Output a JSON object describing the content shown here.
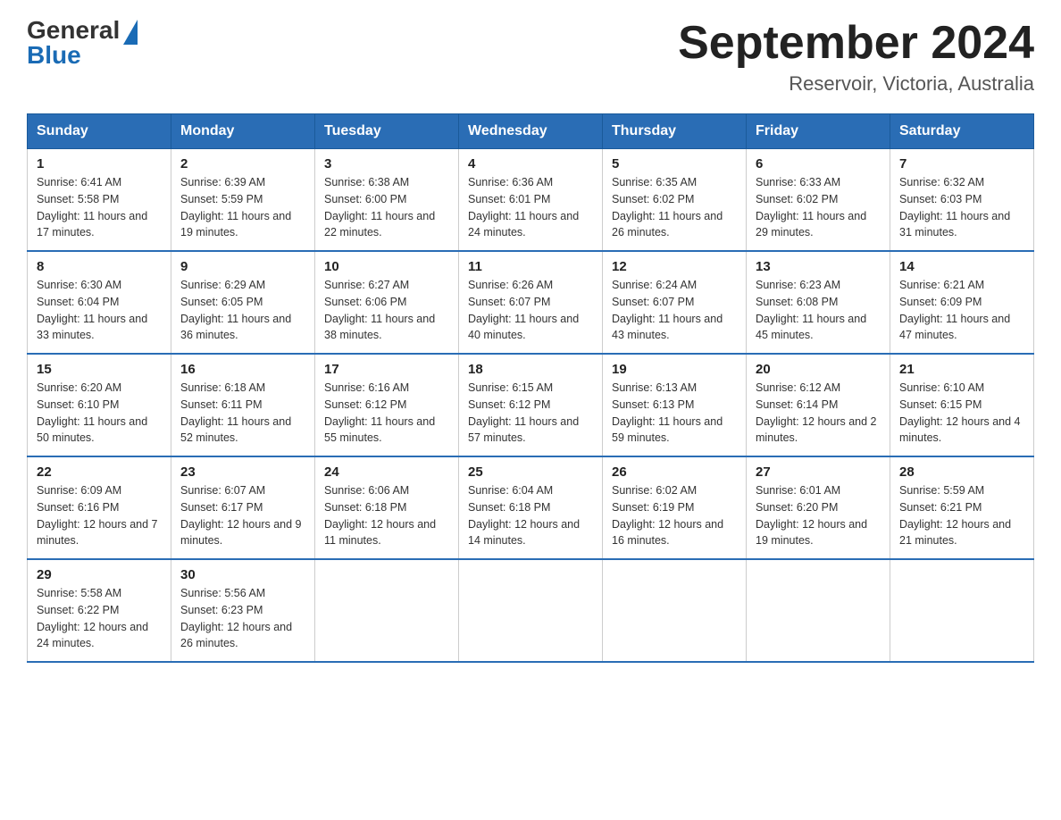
{
  "header": {
    "title": "September 2024",
    "subtitle": "Reservoir, Victoria, Australia",
    "logo_general": "General",
    "logo_blue": "Blue"
  },
  "days_of_week": [
    "Sunday",
    "Monday",
    "Tuesday",
    "Wednesday",
    "Thursday",
    "Friday",
    "Saturday"
  ],
  "weeks": [
    [
      {
        "day": "1",
        "sunrise": "6:41 AM",
        "sunset": "5:58 PM",
        "daylight": "11 hours and 17 minutes."
      },
      {
        "day": "2",
        "sunrise": "6:39 AM",
        "sunset": "5:59 PM",
        "daylight": "11 hours and 19 minutes."
      },
      {
        "day": "3",
        "sunrise": "6:38 AM",
        "sunset": "6:00 PM",
        "daylight": "11 hours and 22 minutes."
      },
      {
        "day": "4",
        "sunrise": "6:36 AM",
        "sunset": "6:01 PM",
        "daylight": "11 hours and 24 minutes."
      },
      {
        "day": "5",
        "sunrise": "6:35 AM",
        "sunset": "6:02 PM",
        "daylight": "11 hours and 26 minutes."
      },
      {
        "day": "6",
        "sunrise": "6:33 AM",
        "sunset": "6:02 PM",
        "daylight": "11 hours and 29 minutes."
      },
      {
        "day": "7",
        "sunrise": "6:32 AM",
        "sunset": "6:03 PM",
        "daylight": "11 hours and 31 minutes."
      }
    ],
    [
      {
        "day": "8",
        "sunrise": "6:30 AM",
        "sunset": "6:04 PM",
        "daylight": "11 hours and 33 minutes."
      },
      {
        "day": "9",
        "sunrise": "6:29 AM",
        "sunset": "6:05 PM",
        "daylight": "11 hours and 36 minutes."
      },
      {
        "day": "10",
        "sunrise": "6:27 AM",
        "sunset": "6:06 PM",
        "daylight": "11 hours and 38 minutes."
      },
      {
        "day": "11",
        "sunrise": "6:26 AM",
        "sunset": "6:07 PM",
        "daylight": "11 hours and 40 minutes."
      },
      {
        "day": "12",
        "sunrise": "6:24 AM",
        "sunset": "6:07 PM",
        "daylight": "11 hours and 43 minutes."
      },
      {
        "day": "13",
        "sunrise": "6:23 AM",
        "sunset": "6:08 PM",
        "daylight": "11 hours and 45 minutes."
      },
      {
        "day": "14",
        "sunrise": "6:21 AM",
        "sunset": "6:09 PM",
        "daylight": "11 hours and 47 minutes."
      }
    ],
    [
      {
        "day": "15",
        "sunrise": "6:20 AM",
        "sunset": "6:10 PM",
        "daylight": "11 hours and 50 minutes."
      },
      {
        "day": "16",
        "sunrise": "6:18 AM",
        "sunset": "6:11 PM",
        "daylight": "11 hours and 52 minutes."
      },
      {
        "day": "17",
        "sunrise": "6:16 AM",
        "sunset": "6:12 PM",
        "daylight": "11 hours and 55 minutes."
      },
      {
        "day": "18",
        "sunrise": "6:15 AM",
        "sunset": "6:12 PM",
        "daylight": "11 hours and 57 minutes."
      },
      {
        "day": "19",
        "sunrise": "6:13 AM",
        "sunset": "6:13 PM",
        "daylight": "11 hours and 59 minutes."
      },
      {
        "day": "20",
        "sunrise": "6:12 AM",
        "sunset": "6:14 PM",
        "daylight": "12 hours and 2 minutes."
      },
      {
        "day": "21",
        "sunrise": "6:10 AM",
        "sunset": "6:15 PM",
        "daylight": "12 hours and 4 minutes."
      }
    ],
    [
      {
        "day": "22",
        "sunrise": "6:09 AM",
        "sunset": "6:16 PM",
        "daylight": "12 hours and 7 minutes."
      },
      {
        "day": "23",
        "sunrise": "6:07 AM",
        "sunset": "6:17 PM",
        "daylight": "12 hours and 9 minutes."
      },
      {
        "day": "24",
        "sunrise": "6:06 AM",
        "sunset": "6:18 PM",
        "daylight": "12 hours and 11 minutes."
      },
      {
        "day": "25",
        "sunrise": "6:04 AM",
        "sunset": "6:18 PM",
        "daylight": "12 hours and 14 minutes."
      },
      {
        "day": "26",
        "sunrise": "6:02 AM",
        "sunset": "6:19 PM",
        "daylight": "12 hours and 16 minutes."
      },
      {
        "day": "27",
        "sunrise": "6:01 AM",
        "sunset": "6:20 PM",
        "daylight": "12 hours and 19 minutes."
      },
      {
        "day": "28",
        "sunrise": "5:59 AM",
        "sunset": "6:21 PM",
        "daylight": "12 hours and 21 minutes."
      }
    ],
    [
      {
        "day": "29",
        "sunrise": "5:58 AM",
        "sunset": "6:22 PM",
        "daylight": "12 hours and 24 minutes."
      },
      {
        "day": "30",
        "sunrise": "5:56 AM",
        "sunset": "6:23 PM",
        "daylight": "12 hours and 26 minutes."
      },
      null,
      null,
      null,
      null,
      null
    ]
  ],
  "labels": {
    "sunrise": "Sunrise:",
    "sunset": "Sunset:",
    "daylight": "Daylight:"
  }
}
